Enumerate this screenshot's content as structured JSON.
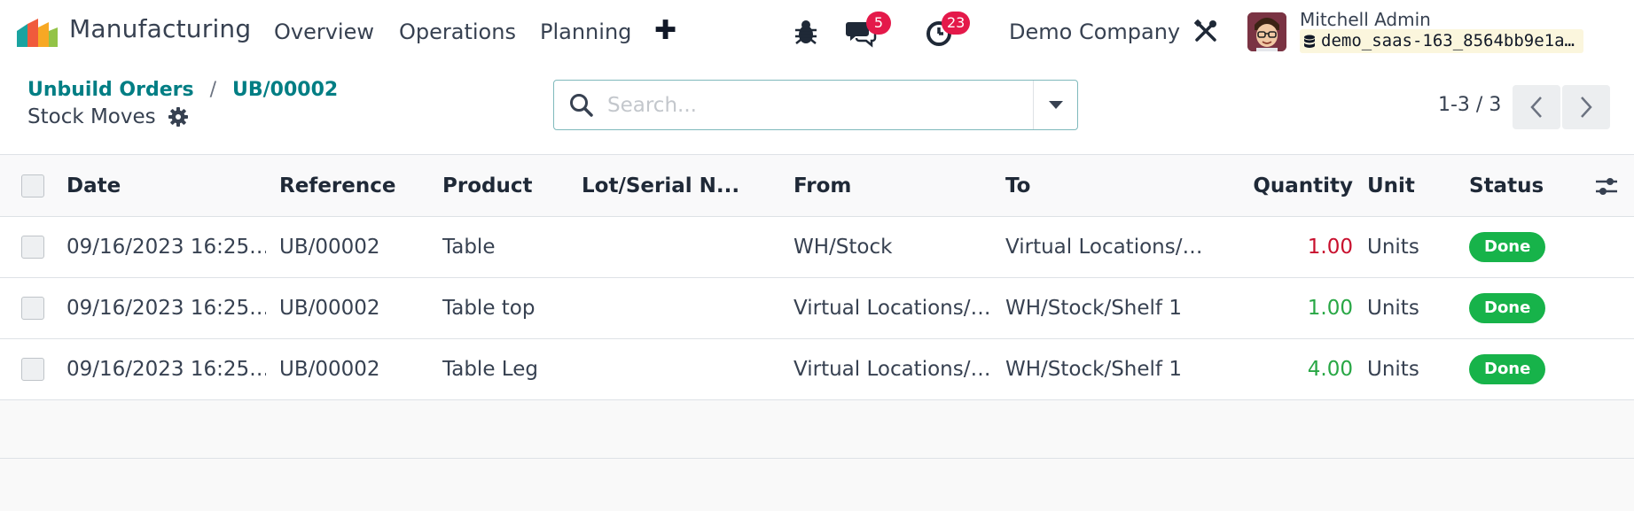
{
  "navbar": {
    "app_name": "Manufacturing",
    "menu": [
      "Overview",
      "Operations",
      "Planning"
    ],
    "messages_count": "5",
    "activities_count": "23",
    "company": "Demo Company",
    "user_name": "Mitchell Admin",
    "database": "demo_saas-163_8564bb9e1a…"
  },
  "breadcrumb": {
    "parent": "Unbuild Orders",
    "record": "UB/00002",
    "separator": "/"
  },
  "page_title": "Stock Moves",
  "search": {
    "placeholder": "Search..."
  },
  "pager": {
    "value": "1-3 / 3"
  },
  "table": {
    "columns": {
      "date": "Date",
      "reference": "Reference",
      "product": "Product",
      "lot": "Lot/Serial N...",
      "from": "From",
      "to": "To",
      "quantity": "Quantity",
      "unit": "Unit",
      "status": "Status"
    },
    "rows": [
      {
        "date": "09/16/2023 16:25…",
        "reference": "UB/00002",
        "product": "Table",
        "lot": "",
        "from": "WH/Stock",
        "to": "Virtual Locations/…",
        "quantity": "1.00",
        "unit": "Units",
        "status": "Done"
      },
      {
        "date": "09/16/2023 16:25…",
        "reference": "UB/00002",
        "product": "Table top",
        "lot": "",
        "from": "Virtual Locations/…",
        "to": "WH/Stock/Shelf 1",
        "quantity": "1.00",
        "unit": "Units",
        "status": "Done"
      },
      {
        "date": "09/16/2023 16:25…",
        "reference": "UB/00002",
        "product": "Table Leg",
        "lot": "",
        "from": "Virtual Locations/…",
        "to": "WH/Stock/Shelf 1",
        "quantity": "4.00",
        "unit": "Units",
        "status": "Done"
      }
    ]
  },
  "colors": {
    "accent": "#017e84",
    "badge_red": "#e4194a",
    "done_green": "#17b34a",
    "qty_outgoing": "#c8102e",
    "qty_incoming": "#28a745"
  },
  "icons": [
    "manufacturing-logo-icon",
    "plus-icon",
    "bug-icon",
    "chat-icon",
    "clock-icon",
    "tools-icon",
    "database-icon",
    "gear-icon",
    "search-icon",
    "caret-down-icon",
    "chevron-left-icon",
    "chevron-right-icon",
    "optional-columns-icon"
  ]
}
